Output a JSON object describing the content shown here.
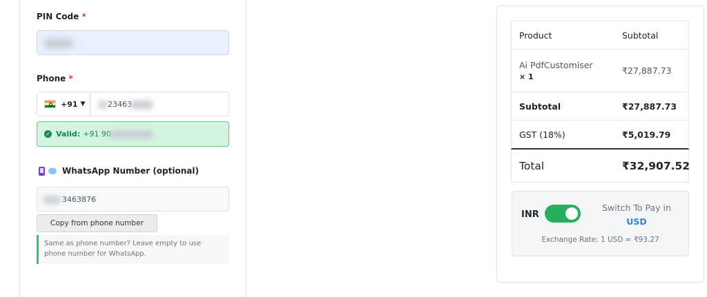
{
  "form": {
    "pin_label": "PIN Code",
    "required_mark": "*",
    "phone_label": "Phone",
    "country_code": "+91",
    "caret": "▼",
    "phone_value": "23463",
    "valid_label": "Valid:",
    "valid_value": "+91 90",
    "whatsapp_label": "WhatsApp Number (optional)",
    "whatsapp_value": "3463876",
    "copy_button": "Copy from phone number",
    "hint": "Same as phone number? Leave empty to use phone number for WhatsApp."
  },
  "order": {
    "col_product": "Product",
    "col_subtotal": "Subtotal",
    "product_name": "Ai PdfCustomiser",
    "product_qty": "× 1",
    "product_price": "₹27,887.73",
    "subtotal_label": "Subtotal",
    "subtotal_value": "₹27,887.73",
    "gst_label": "GST (18%)",
    "gst_value": "₹5,019.79",
    "total_label": "Total",
    "total_value": "₹32,907.52"
  },
  "currency": {
    "current": "INR",
    "switch_text": "Switch To Pay in",
    "target": "USD",
    "exchange_rate": "Exchange Rate: 1 USD = ₹93.27",
    "toggle_on": true
  },
  "colors": {
    "accent_green": "#27ae60",
    "link_blue": "#2f80ed",
    "required_red": "#dc3545"
  }
}
